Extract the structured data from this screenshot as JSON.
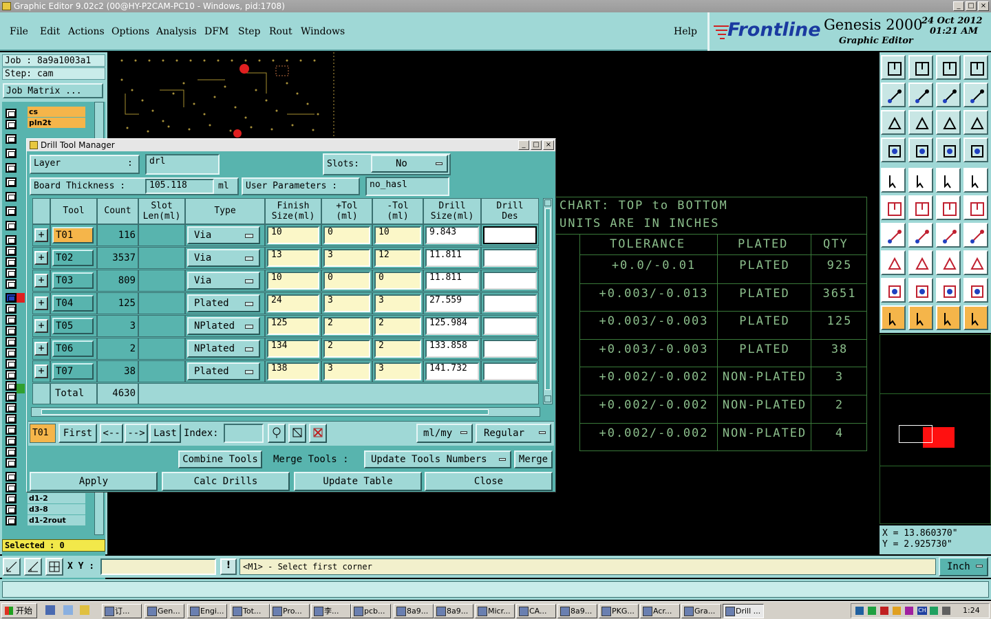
{
  "window": {
    "title": "Graphic Editor 9.02c2 (00@HY-P2CAM-PC10 - Windows, pid:1708)"
  },
  "menu": {
    "items": [
      "File",
      "Edit",
      "Actions",
      "Options",
      "Analysis",
      "DFM",
      "Step",
      "Rout",
      "Windows"
    ],
    "help": "Help"
  },
  "brand": {
    "logo": "Frontline",
    "product": "Genesis 2000",
    "subtitle": "Graphic Editor",
    "date": "24 Oct 2012",
    "time": "01:21 AM"
  },
  "left_panel": {
    "job": "Job : 8a9a1003a1",
    "step": "Step: cam",
    "job_matrix": "Job Matrix ...",
    "layers_top": [
      "cs",
      "pln2t"
    ],
    "layers_bottom": [
      "d1-2",
      "d3-8",
      "d1-2rout"
    ],
    "selected": "Selected : 0"
  },
  "drill_chart": {
    "title_line1": "CHART: TOP to BOTTOM",
    "title_line2": "UNITS ARE IN INCHES",
    "headers": [
      "TOLERANCE",
      "PLATED",
      "QTY"
    ],
    "rows": [
      {
        "tol": "+0.0/-0.01",
        "plated": "PLATED",
        "qty": "925"
      },
      {
        "tol": "+0.003/-0.013",
        "plated": "PLATED",
        "qty": "3651"
      },
      {
        "tol": "+0.003/-0.003",
        "plated": "PLATED",
        "qty": "125"
      },
      {
        "tol": "+0.003/-0.003",
        "plated": "PLATED",
        "qty": "38"
      },
      {
        "tol": "+0.002/-0.002",
        "plated": "NON-PLATED",
        "qty": "3"
      },
      {
        "tol": "+0.002/-0.002",
        "plated": "NON-PLATED",
        "qty": "2"
      },
      {
        "tol": "+0.002/-0.002",
        "plated": "NON-PLATED",
        "qty": "4"
      }
    ]
  },
  "coords": {
    "x": "X = 13.860370\"",
    "y": "Y = 2.925730\""
  },
  "dialog": {
    "title": "Drill Tool Manager",
    "layer_label": "Layer",
    "layer_colon": ":",
    "layer_value": "drl",
    "slots_label": "Slots:",
    "slots_value": "No",
    "thickness_label": "Board Thickness :",
    "thickness_value": "105.118",
    "thickness_unit": "ml",
    "user_params_label": "User Parameters :",
    "user_params_value": "no_hasl",
    "columns": {
      "tool": "Tool",
      "count": "Count",
      "slot1": "Slot",
      "slot2": "Len(ml)",
      "type": "Type",
      "finish1": "Finish",
      "finish2": "Size(ml)",
      "ptol1": "+Tol",
      "ptol2": "(ml)",
      "ntol1": "-Tol",
      "ntol2": "(ml)",
      "drill1": "Drill",
      "drill2": "Size(ml)",
      "des1": "Drill",
      "des2": "Des"
    },
    "rows": [
      {
        "tool": "T01",
        "count": "116",
        "type": "Via",
        "finish": "10",
        "ptol": "0",
        "ntol": "10",
        "drill": "9.843",
        "des": ""
      },
      {
        "tool": "T02",
        "count": "3537",
        "type": "Via",
        "finish": "13",
        "ptol": "3",
        "ntol": "12",
        "drill": "11.811",
        "des": ""
      },
      {
        "tool": "T03",
        "count": "809",
        "type": "Via",
        "finish": "10",
        "ptol": "0",
        "ntol": "0",
        "drill": "11.811",
        "des": ""
      },
      {
        "tool": "T04",
        "count": "125",
        "type": "Plated",
        "finish": "24",
        "ptol": "3",
        "ntol": "3",
        "drill": "27.559",
        "des": ""
      },
      {
        "tool": "T05",
        "count": "3",
        "type": "NPlated",
        "finish": "125",
        "ptol": "2",
        "ntol": "2",
        "drill": "125.984",
        "des": ""
      },
      {
        "tool": "T06",
        "count": "2",
        "type": "NPlated",
        "finish": "134",
        "ptol": "2",
        "ntol": "2",
        "drill": "133.858",
        "des": ""
      },
      {
        "tool": "T07",
        "count": "38",
        "type": "Plated",
        "finish": "138",
        "ptol": "3",
        "ntol": "3",
        "drill": "141.732",
        "des": ""
      }
    ],
    "total_label": "Total",
    "total_count": "4630",
    "nav": {
      "current": "T01",
      "first": "First",
      "prev": "<--",
      "next": "-->",
      "last": "Last",
      "index_label": "Index:",
      "units": "ml/my",
      "mode": "Regular"
    },
    "combine": "Combine Tools",
    "merge_label": "Merge Tools :",
    "update_numbers": "Update Tools Numbers",
    "merge": "Merge",
    "apply": "Apply",
    "calc": "Calc Drills",
    "update_table": "Update Table",
    "close": "Close"
  },
  "cmd": {
    "xy_label": "X Y :",
    "prompt": "<M1> - Select first corner",
    "units": "Inch"
  },
  "taskbar": {
    "start": "开始",
    "tasks": [
      "订...",
      "Gen...",
      "Engi...",
      "Tot...",
      "Pro...",
      "李...",
      "pcb...",
      "8a9...",
      "8a9...",
      "Micr...",
      "CA...",
      "8a9...",
      "PKG...",
      "Acr...",
      "Gra...",
      "Drill ..."
    ],
    "clock": "1:24"
  }
}
